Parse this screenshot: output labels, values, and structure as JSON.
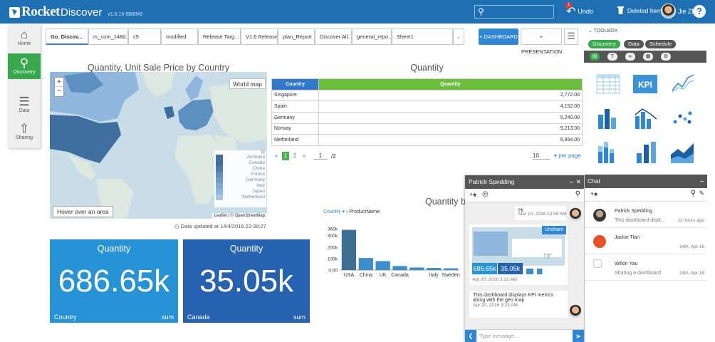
{
  "app": {
    "name": "Rocket",
    "name2": "Discover",
    "version": "v1.6.15-f886f49"
  },
  "header": {
    "search_placeholder": "",
    "undo_label": "Undo",
    "undo_badge": "1",
    "deleted_label": "Deleted Items",
    "user_name": "Jie Zhu",
    "help_label": "?"
  },
  "sidebar": {
    "items": [
      {
        "label": "Home",
        "icon": "home-icon"
      },
      {
        "label": "Discovery",
        "icon": "search-icon",
        "active": true
      },
      {
        "label": "Data",
        "icon": "database-icon"
      },
      {
        "label": "Sharing",
        "icon": "share-icon"
      }
    ]
  },
  "tabs": [
    {
      "label": "Go_Discov..."
    },
    {
      "label": "rs_com_148d.."
    },
    {
      "label": "c5"
    },
    {
      "label": "modified"
    },
    {
      "label": "Release Targ..."
    },
    {
      "label": "V1.6 Release..."
    },
    {
      "label": "plan_Report"
    },
    {
      "label": "Discover All..."
    },
    {
      "label": "general_repo..."
    },
    {
      "label": "Sheet1"
    }
  ],
  "toolbar": {
    "dashboard_label": "+ DASHBOARD",
    "presentation_label": "+ PRESENTATION"
  },
  "map_panel": {
    "title": "Quantity, Unit Sale Price by Country",
    "world_map_label": "World map",
    "hover_text": "Hover over an area",
    "attribution": "Leaflet | © OpenStreetMap",
    "updated": "Data updated at 14/4/2016 22:38:27",
    "legend": [
      "Australia",
      "Canada",
      "China",
      "France",
      "Germany",
      "Italy",
      "Japan",
      "Netherland"
    ],
    "colors": {
      "land_light": "#dce8e0",
      "water": "#c9dde9",
      "blue_dark": "#3e6f9f",
      "blue_mid": "#5d8fc2",
      "blue_light": "#8fb6dc"
    }
  },
  "table_panel": {
    "title": "Quantity",
    "headers": [
      "Country",
      "Quantity"
    ],
    "rows": [
      [
        "Singapore",
        "2,772.00"
      ],
      [
        "Spain",
        "4,152.00"
      ],
      [
        "Germany",
        "5,240.00"
      ],
      [
        "Norway",
        "9,213.00"
      ],
      [
        "Netherland",
        "6,954.00"
      ]
    ],
    "pager": {
      "prev": "«",
      "pages": [
        "1",
        "2"
      ],
      "next": "»",
      "current": "1",
      "total": "/2",
      "per_page_value": "10",
      "per_page_label": "per page"
    }
  },
  "kpis": [
    {
      "title": "Quantity",
      "value": "686.65k",
      "label_left": "Country",
      "label_right": "sum",
      "color": "#2693d6"
    },
    {
      "title": "Quantity",
      "value": "35.05k",
      "label_left": "Canada",
      "label_right": "sum",
      "color": "#2762b0"
    }
  ],
  "bar_panel": {
    "title": "Quantity by Co",
    "crumb_link": "Country",
    "crumb_sep": "›",
    "crumb_rest": "ProductName"
  },
  "chart_data": {
    "type": "bar",
    "categories": [
      "USA",
      "China",
      "UK",
      "Canada",
      "",
      "Italy",
      "Sweden"
    ],
    "values": [
      350,
      105,
      78,
      35,
      22,
      18,
      15
    ],
    "ylim": [
      0,
      360
    ],
    "yticks": [
      "360k",
      "300k",
      "200k",
      "100k",
      "0.00"
    ],
    "xlabel": "",
    "ylabel": "",
    "colors": {
      "first": "#3c6f93",
      "rest": "#3c8dc9"
    }
  },
  "toolbox": {
    "title": "TOOLBOX",
    "tabs": [
      "Discovery",
      "Data",
      "Schedule"
    ],
    "charts": [
      "table-chart-icon",
      "kpi-chart-icon",
      "line-chart-icon",
      "bar-chart-icon",
      "combo-chart-icon",
      "scatter-chart-icon",
      "stacked-bar-chart-icon",
      "column-chart-icon",
      "area-chart-icon"
    ],
    "kpi_label": "KPI"
  },
  "chat": {
    "title": "Chat",
    "items": [
      {
        "name": "Patrick Spedding",
        "message": "This dashboard displ...",
        "time": "11 hours ago"
      },
      {
        "name": "Jackie Tian",
        "message": "",
        "time": "14th, Apr 16"
      },
      {
        "name": "Wilkin Yau",
        "message": "Sharing a dashboard",
        "time": "14th, Apr 16"
      }
    ]
  },
  "conversation": {
    "title": "Patrick Spedding",
    "messages": [
      {
        "text": "Hi",
        "time": "Mar 10, 2016 12:59 AM"
      },
      {
        "text": "",
        "time": "Apr 20, 2016 3:22 AM",
        "unshare": "Unshare",
        "thumb_values": [
          "686.65k",
          "35.05k"
        ]
      },
      {
        "text": "This dashboard displays KPI metrics along with the geo map",
        "time": "Apr 20, 2016 3:23 AM"
      }
    ],
    "input_placeholder": "Type message..."
  }
}
